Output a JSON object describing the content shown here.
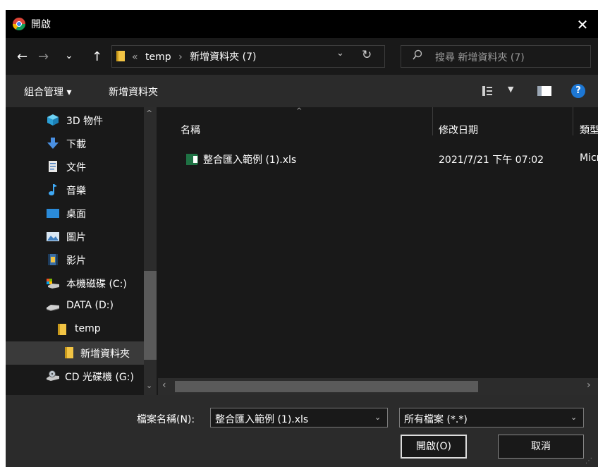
{
  "window": {
    "title": "開啟",
    "close_glyph": "✕"
  },
  "nav": {
    "back_glyph": "←",
    "forward_glyph": "→",
    "recent_glyph": "⌄",
    "up_glyph": "↑",
    "breadcrumb_prefix": "«",
    "breadcrumb": [
      "temp",
      "新增資料夾 (7)"
    ],
    "breadcrumb_sep": "›",
    "dropdown_glyph": "⌄",
    "refresh_glyph": "↻",
    "search_placeholder": "搜尋 新增資料夾 (7)",
    "search_glyph": "⚲"
  },
  "toolbar": {
    "organize_label": "組合管理 ▾",
    "new_folder_label": "新增資料夾",
    "view_drop_glyph": "▼",
    "help_glyph": "?"
  },
  "sidebar": {
    "items": [
      {
        "label": "3D 物件",
        "icon": "3d-objects-icon",
        "indent": 1
      },
      {
        "label": "下載",
        "icon": "download-icon",
        "indent": 1
      },
      {
        "label": "文件",
        "icon": "documents-icon",
        "indent": 1
      },
      {
        "label": "音樂",
        "icon": "music-icon",
        "indent": 1
      },
      {
        "label": "桌面",
        "icon": "desktop-icon",
        "indent": 1
      },
      {
        "label": "圖片",
        "icon": "pictures-icon",
        "indent": 1
      },
      {
        "label": "影片",
        "icon": "videos-icon",
        "indent": 1
      },
      {
        "label": "本機磁碟 (C:)",
        "icon": "drive-c-icon",
        "indent": 1
      },
      {
        "label": "DATA (D:)",
        "icon": "drive-d-icon",
        "indent": 1
      },
      {
        "label": "temp",
        "icon": "folder-icon",
        "indent": 2
      },
      {
        "label": "新增資料夾",
        "icon": "folder-icon",
        "indent": 3,
        "selected": true
      },
      {
        "label": "CD 光碟機 (G:)",
        "icon": "cd-drive-icon",
        "indent": 1
      }
    ],
    "scroll_up_glyph": "^",
    "scroll_down_glyph": "⌄"
  },
  "filelist": {
    "columns": [
      "名稱",
      "修改日期",
      "類型"
    ],
    "sort_glyph": "^",
    "rows": [
      {
        "name": "整合匯入範例 (1).xls",
        "date": "2021/7/21 下午 07:02",
        "type": "Micro"
      }
    ],
    "hscroll_left": "‹",
    "hscroll_right": "›"
  },
  "footer": {
    "filename_label": "檔案名稱(N):",
    "filename_value": "整合匯入範例 (1).xls",
    "filter_value": "所有檔案 (*.*)",
    "dropdown_glyph": "⌄",
    "open_label": "開啟(O)",
    "cancel_label": "取消"
  },
  "colors": {
    "accent": "#1d77d4",
    "folder": "#f2c444",
    "background": "#191919",
    "toolbar": "#2b2b2b"
  }
}
